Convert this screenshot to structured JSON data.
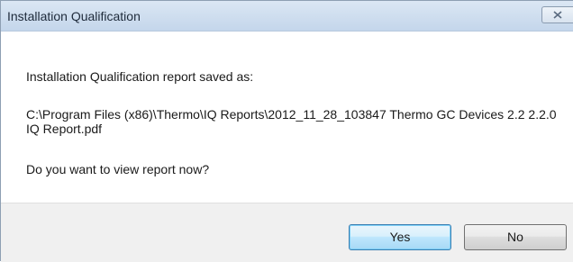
{
  "window": {
    "title": "Installation Qualification"
  },
  "message": {
    "line1": "Installation Qualification report saved as:",
    "path": "C:\\Program Files (x86)\\Thermo\\IQ Reports\\2012_11_28_103847 Thermo GC Devices 2.2 2.2.0 IQ Report.pdf",
    "question": "Do you want to view report now?"
  },
  "buttons": {
    "yes_label": "Yes",
    "no_label": "No"
  },
  "icons": {
    "close": "close-icon"
  }
}
